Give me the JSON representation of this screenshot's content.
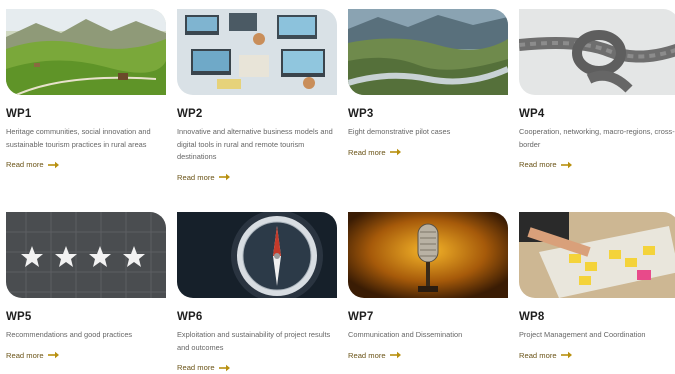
{
  "cards": [
    {
      "title": "WP1",
      "desc": "Heritage communities, social innovation and sustainable tourism practices in rural areas",
      "more": "Read more"
    },
    {
      "title": "WP2",
      "desc": "Innovative and alternative business models and digital tools in rural and remote tourism destinations",
      "more": "Read more"
    },
    {
      "title": "WP3",
      "desc": "Eight demonstrative pilot cases",
      "more": "Read more"
    },
    {
      "title": "WP4",
      "desc": "Cooperation, networking, macro-regions, cross-border",
      "more": "Read more"
    },
    {
      "title": "WP5",
      "desc": "Recommendations and good practices",
      "more": "Read more"
    },
    {
      "title": "WP6",
      "desc": "Exploitation and sustainability of project results and outcomes",
      "more": "Read more"
    },
    {
      "title": "WP7",
      "desc": "Communication and Dissemination",
      "more": "Read more"
    },
    {
      "title": "WP8",
      "desc": "Project Management and Coordination",
      "more": "Read more"
    }
  ],
  "colors": {
    "accent": "#6b5418",
    "arrow": "#b8900f",
    "title": "#1e1e1e",
    "text": "#666666"
  },
  "icons": {
    "read_more": "arrow-right-icon"
  }
}
